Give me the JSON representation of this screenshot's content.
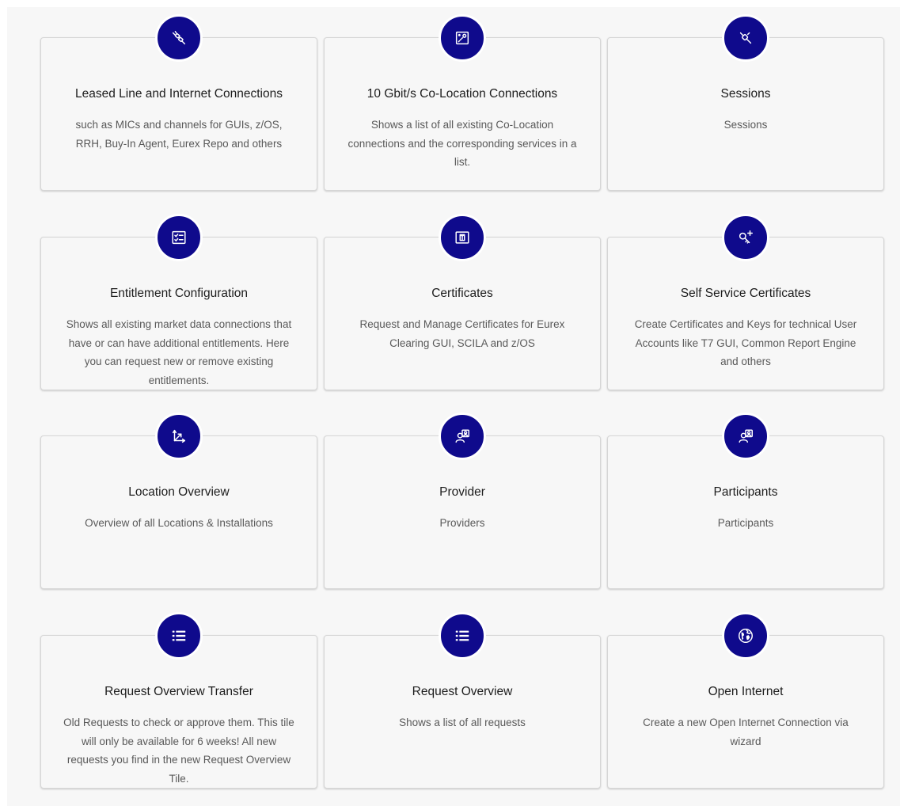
{
  "tiles": [
    {
      "title": "Leased Line and Internet Connections",
      "description": "such as MICs and channels for GUIs, z/OS, RRH, Buy-In Agent, Eurex Repo and others",
      "icon": "plug-connection-icon"
    },
    {
      "title": "10 Gbit/s Co-Location Connections",
      "description": "Shows a list of all existing Co-Location connections and the corresponding services in a list.",
      "icon": "network-map-icon"
    },
    {
      "title": "Sessions",
      "description": "Sessions",
      "icon": "disconnected-plug-icon"
    },
    {
      "title": "Entitlement Configuration",
      "description": "Shows all existing market data connections that have or can have additional entitlements. Here you can request new or remove existing entitlements.",
      "icon": "checklist-icon"
    },
    {
      "title": "Certificates",
      "description": "Request and Manage Certificates for Eurex Clearing GUI, SCILA and z/OS",
      "icon": "certificate-icon"
    },
    {
      "title": "Self Service Certificates",
      "description": "Create Certificates and Keys for technical User Accounts like T7 GUI, Common Report Engine and others",
      "icon": "key-add-icon"
    },
    {
      "title": "Location Overview",
      "description": "Overview of all Locations & Installations",
      "icon": "axis-arrows-icon"
    },
    {
      "title": "Provider",
      "description": "Providers",
      "icon": "group-icon"
    },
    {
      "title": "Participants",
      "description": "Participants",
      "icon": "group-icon"
    },
    {
      "title": "Request Overview Transfer",
      "description": "Old Requests to check or approve them. This tile will only be available for 6 weeks! All new requests you find in the new Request Overview Tile.",
      "icon": "list-icon"
    },
    {
      "title": "Request Overview",
      "description": "Shows a list of all requests",
      "icon": "list-icon"
    },
    {
      "title": "Open Internet",
      "description": "Create a new Open Internet Connection via wizard",
      "icon": "globe-icon"
    }
  ],
  "colors": {
    "icon_circle": "#0f0a8c",
    "page_background": "#f7f7f7",
    "tile_border": "#d6d6d6"
  }
}
